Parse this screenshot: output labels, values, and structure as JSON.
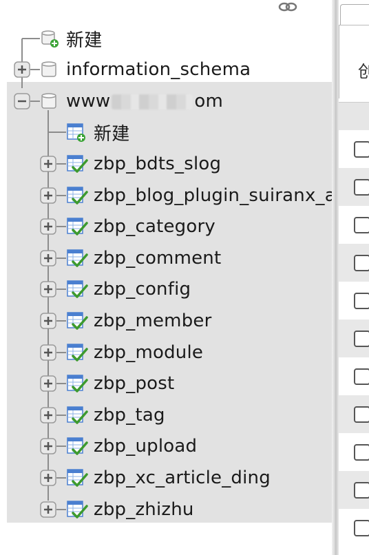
{
  "tree": {
    "root_new_label": "新建",
    "databases": [
      {
        "name": "information_schema",
        "expanded": false
      },
      {
        "name_start": "www",
        "name_end": "om",
        "expanded": true
      }
    ],
    "db_new_label": "新建",
    "tables": [
      "zbp_bdts_slog",
      "zbp_blog_plugin_suiranx_ai",
      "zbp_category",
      "zbp_comment",
      "zbp_config",
      "zbp_member",
      "zbp_module",
      "zbp_post",
      "zbp_tag",
      "zbp_upload",
      "zbp_xc_article_ding",
      "zbp_zhizhu"
    ]
  },
  "right_panel": {
    "toolbar_label": "创"
  },
  "colors": {
    "tree_line": "#8c8c8c",
    "selected_block_bg": "#e2e2e2",
    "table_icon_blue": "#4a7fd0",
    "table_icon_green": "#3d9a2e"
  }
}
